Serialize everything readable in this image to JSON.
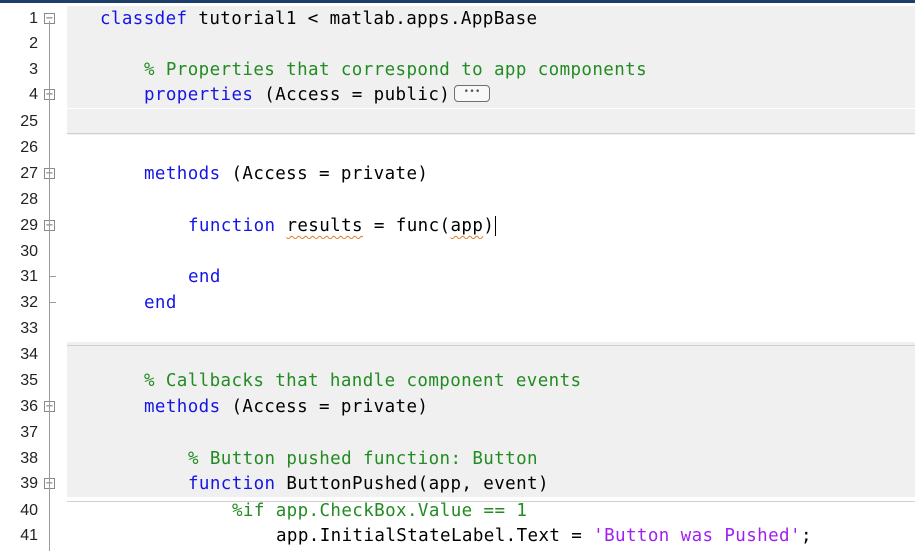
{
  "editor": {
    "lines": [
      {
        "n": "1",
        "fold": "minus",
        "parts": [
          {
            "c": "kw",
            "t": "classdef"
          },
          {
            "c": "pl",
            "t": " tutorial1 < matlab.apps.AppBase"
          }
        ],
        "indent": 0,
        "bg": "shaded"
      },
      {
        "n": "2",
        "fold": "",
        "parts": [],
        "indent": 0,
        "bg": "shaded"
      },
      {
        "n": "3",
        "fold": "",
        "parts": [
          {
            "c": "cm",
            "t": "% Properties that correspond to app components"
          }
        ],
        "indent": 1,
        "bg": "shaded"
      },
      {
        "n": "4",
        "fold": "plus",
        "parts": [
          {
            "c": "kw",
            "t": "properties"
          },
          {
            "c": "pl",
            "t": " (Access = public)"
          }
        ],
        "indent": 1,
        "bg": "shaded",
        "collapsed_label": "•••"
      },
      {
        "n": "25",
        "fold": "",
        "parts": [],
        "indent": 0,
        "bg": "shaded"
      },
      {
        "n": "26",
        "fold": "",
        "parts": [],
        "indent": 0,
        "bg": "white"
      },
      {
        "n": "27",
        "fold": "minus",
        "parts": [
          {
            "c": "kw",
            "t": "methods"
          },
          {
            "c": "pl",
            "t": " (Access = private)"
          }
        ],
        "indent": 1,
        "bg": "white"
      },
      {
        "n": "28",
        "fold": "",
        "parts": [],
        "indent": 0,
        "bg": "white"
      },
      {
        "n": "29",
        "fold": "minus",
        "parts": [
          {
            "c": "kw",
            "t": "function"
          },
          {
            "c": "pl",
            "t": " "
          },
          {
            "c": "pl squig",
            "t": "results"
          },
          {
            "c": "pl",
            "t": " = func("
          },
          {
            "c": "pl squig",
            "t": "app"
          },
          {
            "c": "pl",
            "t": ")"
          }
        ],
        "indent": 2,
        "bg": "white",
        "cursor": true
      },
      {
        "n": "30",
        "fold": "",
        "parts": [],
        "indent": 0,
        "bg": "white"
      },
      {
        "n": "31",
        "fold": "",
        "parts": [
          {
            "c": "kw",
            "t": "end"
          }
        ],
        "indent": 2,
        "bg": "white"
      },
      {
        "n": "32",
        "fold": "",
        "parts": [
          {
            "c": "kw",
            "t": "end"
          }
        ],
        "indent": 1,
        "bg": "white"
      },
      {
        "n": "33",
        "fold": "",
        "parts": [],
        "indent": 0,
        "bg": "white"
      },
      {
        "n": "34",
        "fold": "",
        "parts": [],
        "indent": 0,
        "bg": "shaded"
      },
      {
        "n": "35",
        "fold": "",
        "parts": [
          {
            "c": "cm",
            "t": "% Callbacks that handle component events"
          }
        ],
        "indent": 1,
        "bg": "shaded"
      },
      {
        "n": "36",
        "fold": "minus",
        "parts": [
          {
            "c": "kw",
            "t": "methods"
          },
          {
            "c": "pl",
            "t": " (Access = private)"
          }
        ],
        "indent": 1,
        "bg": "shaded"
      },
      {
        "n": "37",
        "fold": "",
        "parts": [],
        "indent": 0,
        "bg": "shaded"
      },
      {
        "n": "38",
        "fold": "",
        "parts": [
          {
            "c": "cm",
            "t": "% Button pushed function: Button"
          }
        ],
        "indent": 2,
        "bg": "shaded"
      },
      {
        "n": "39",
        "fold": "minus",
        "parts": [
          {
            "c": "kw",
            "t": "function"
          },
          {
            "c": "pl",
            "t": " ButtonPushed(app, event)"
          }
        ],
        "indent": 2,
        "bg": "shaded"
      },
      {
        "n": "40",
        "fold": "",
        "parts": [
          {
            "c": "cm",
            "t": "%if app.CheckBox.Value == 1"
          }
        ],
        "indent": 3,
        "bg": "white"
      },
      {
        "n": "41",
        "fold": "",
        "parts": [
          {
            "c": "pl",
            "t": "app.InitialStateLabel.Text = "
          },
          {
            "c": "st",
            "t": "'Button was Pushed'"
          },
          {
            "c": "pl",
            "t": ";"
          }
        ],
        "indent": 4,
        "bg": "white"
      }
    ]
  }
}
